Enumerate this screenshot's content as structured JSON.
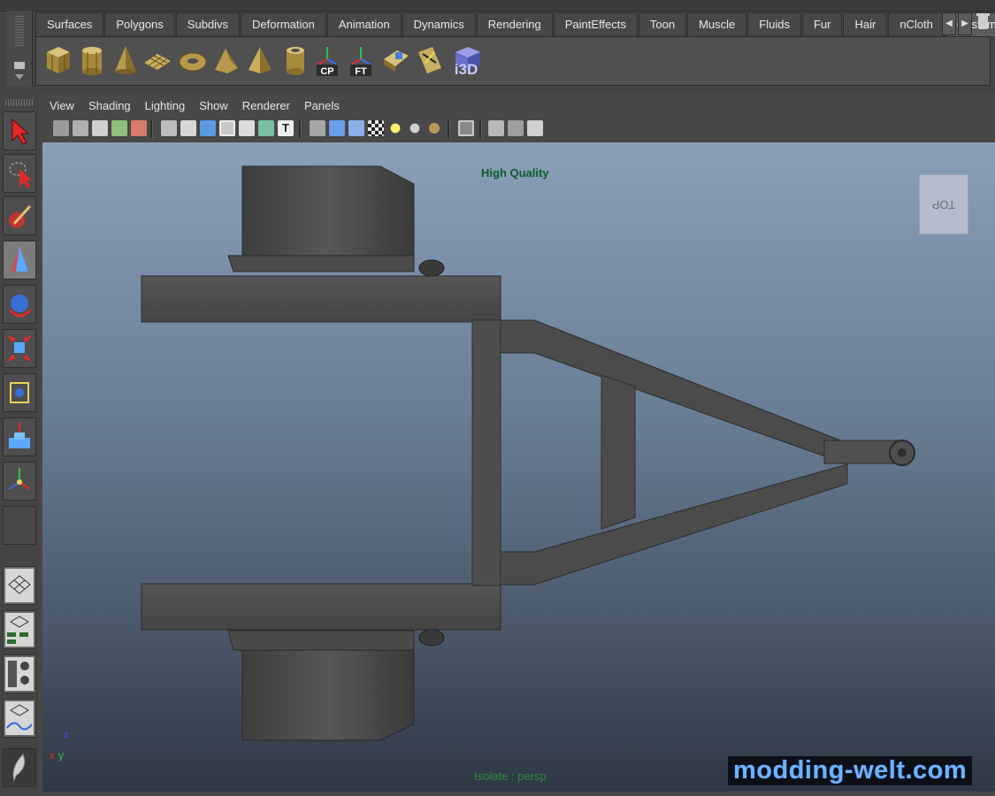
{
  "shelf": {
    "tabs": [
      {
        "label": "Surfaces",
        "active": false
      },
      {
        "label": "Polygons",
        "active": false
      },
      {
        "label": "Subdivs",
        "active": false
      },
      {
        "label": "Deformation",
        "active": false
      },
      {
        "label": "Animation",
        "active": false
      },
      {
        "label": "Dynamics",
        "active": false
      },
      {
        "label": "Rendering",
        "active": false
      },
      {
        "label": "PaintEffects",
        "active": false
      },
      {
        "label": "Toon",
        "active": false
      },
      {
        "label": "Muscle",
        "active": false
      },
      {
        "label": "Fluids",
        "active": false
      },
      {
        "label": "Fur",
        "active": false
      },
      {
        "label": "Hair",
        "active": false
      },
      {
        "label": "nCloth",
        "active": false
      },
      {
        "label": "Custom",
        "active": true
      }
    ],
    "icons": [
      {
        "name": "cube-icon"
      },
      {
        "name": "cylinder-icon"
      },
      {
        "name": "cone-icon"
      },
      {
        "name": "plane-icon"
      },
      {
        "name": "torus-icon"
      },
      {
        "name": "prism-icon"
      },
      {
        "name": "pyramid-icon"
      },
      {
        "name": "pipe-icon"
      },
      {
        "name": "center-pivot-icon",
        "label": "CP"
      },
      {
        "name": "freeze-transform-icon",
        "label": "FT"
      },
      {
        "name": "uv-editor-icon"
      },
      {
        "name": "uv-snapshot-icon"
      },
      {
        "name": "i3d-export-icon",
        "label": "i3D"
      }
    ]
  },
  "panel": {
    "menu": [
      "View",
      "Shading",
      "Lighting",
      "Show",
      "Renderer",
      "Panels"
    ]
  },
  "viewport": {
    "quality_label": "High Quality",
    "isolate_label": "Isolate : persp",
    "viewcube_label": "TOP",
    "axis": {
      "x": "x",
      "y": "y",
      "z": "z"
    }
  },
  "watermark": "modding-welt.com",
  "colors": {
    "ui_bg": "#444444",
    "quality_text": "#0d5c2a",
    "isolate_text": "#2b8a3a",
    "watermark_text": "#6fb2ff",
    "model_gray": "#4b4b4b"
  }
}
